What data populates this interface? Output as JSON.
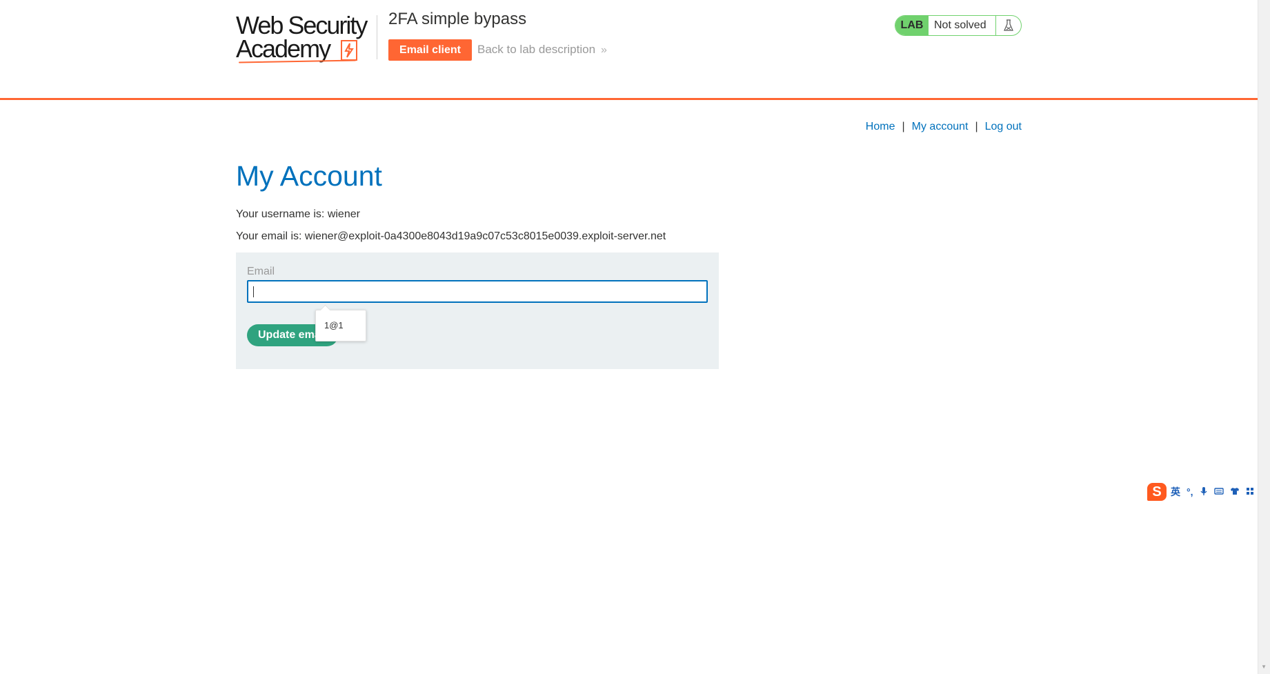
{
  "header": {
    "logo": {
      "line1": "Web Security",
      "line2": "Academy"
    },
    "lab_title": "2FA simple bypass",
    "email_client_label": "Email client",
    "back_link_label": "Back to lab description",
    "back_link_chevron": "»",
    "status": {
      "badge": "LAB",
      "text": "Not solved",
      "icon": "flask-icon"
    }
  },
  "nav": {
    "home": "Home",
    "separator": "|",
    "my_account": "My account",
    "log_out": "Log out"
  },
  "main": {
    "title": "My Account",
    "username_line": "Your username is: wiener",
    "email_line": "Your email is: wiener@exploit-0a4300e8043d19a9c07c53c8015e0039.exploit-server.net",
    "form": {
      "email_label": "Email",
      "email_value": "",
      "update_button_label": "Update email"
    },
    "autocomplete": {
      "option": "1@1"
    }
  },
  "ime_toolbar": {
    "logo": "S",
    "items": [
      "英",
      "°,",
      "mic-icon",
      "keyboard-icon",
      "shirt-icon",
      "grid-icon"
    ]
  },
  "colors": {
    "accent_orange": "#ff6633",
    "link_blue": "#0071bc",
    "button_green": "#2fa37f",
    "lab_green": "#70d16d",
    "panel_bg": "#ebf0f2"
  }
}
